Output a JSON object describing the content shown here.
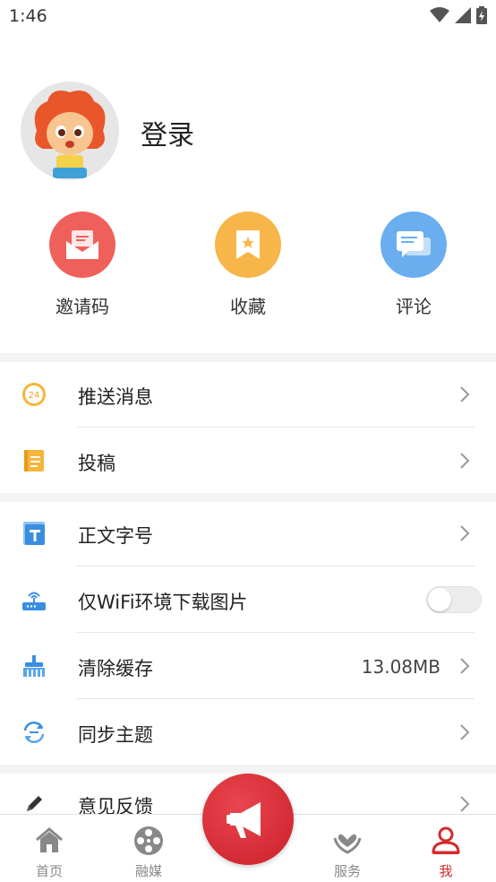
{
  "status_bar": {
    "time": "1:46"
  },
  "profile": {
    "login_label": "登录"
  },
  "shortcuts": [
    {
      "label": "邀请码",
      "icon": "envelope-icon",
      "color": "#f0605a"
    },
    {
      "label": "收藏",
      "icon": "bookmark-icon",
      "color": "#f7b54a"
    },
    {
      "label": "评论",
      "icon": "comment-icon",
      "color": "#6aaef0"
    }
  ],
  "menu": {
    "push": {
      "label": "推送消息",
      "icon": "24-clock-icon"
    },
    "contribute": {
      "label": "投稿",
      "icon": "notepad-icon"
    },
    "font_size": {
      "label": "正文字号",
      "icon": "text-t-icon"
    },
    "wifi_only": {
      "label": "仅WiFi环境下载图片",
      "icon": "router-icon",
      "enabled": false
    },
    "clear_cache": {
      "label": "清除缓存",
      "value": "13.08MB",
      "icon": "broom-icon"
    },
    "sync_theme": {
      "label": "同步主题",
      "icon": "sync-icon"
    },
    "feedback": {
      "label": "意见反馈",
      "icon": "pencil-icon"
    }
  },
  "bottom_nav": {
    "home": "首页",
    "media": "融媒",
    "services": "服务",
    "me": "我",
    "active_color": "#d42a2a"
  }
}
